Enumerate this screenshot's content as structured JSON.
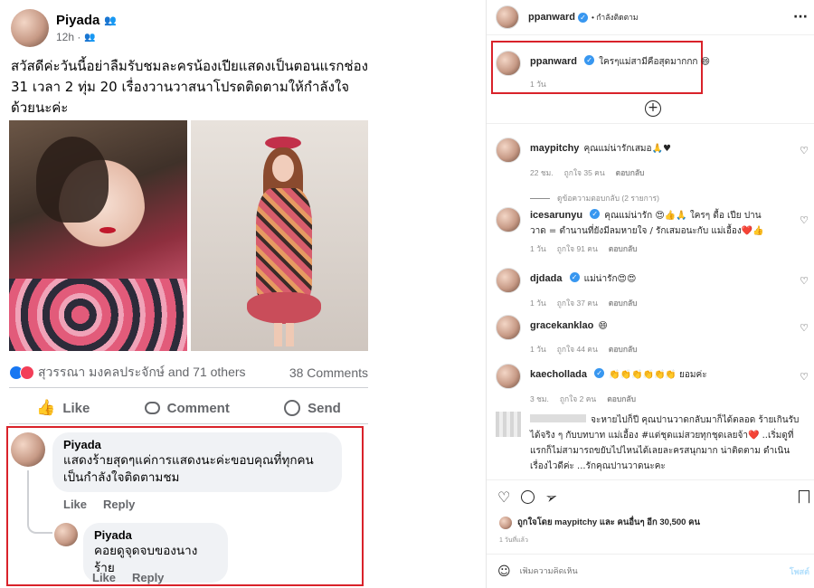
{
  "facebook": {
    "author": "Piyada",
    "meta": "12h ·",
    "post_text": "สวัสดีค่ะวันนี้อย่าลืมรับชมละครน้องเปียแสดงเป็นตอนแรกช่อง 31 เวลา 2 ทุ่ม 20 เรื่องวานวาสนาโปรดติดตามให้กำลังใจด้วยนะค่ะ",
    "reactions_text": "สุวรรณา มงคลประจักษ์ and 71 others",
    "comments_count": "38 Comments",
    "actions": {
      "like": "Like",
      "comment": "Comment",
      "send": "Send"
    },
    "comments": [
      {
        "name": "Piyada",
        "text": "แสดงร้ายสุดๆแค่การแสดงนะค่ะขอบคุณที่ทุกคนเป็นกำลังใจติดตามชม",
        "like": "Like",
        "reply": "Reply"
      },
      {
        "name": "Piyada",
        "text": "คอยดูจุดจบของนางร้าย",
        "like": "Like",
        "reply": "Reply"
      }
    ]
  },
  "instagram": {
    "header_user": "ppanward",
    "header_follow": "• กำลังติดตาม",
    "caption": {
      "user": "ppanward",
      "text": "ใครๆแม่สามีคือสุดมากกก 😄",
      "time": "1 วัน"
    },
    "comments": [
      {
        "user": "maypitchy",
        "verified": false,
        "text": "คุณแม่น่ารักเสมอ🙏♥",
        "time": "22 ชม.",
        "likes": "ถูกใจ 35 คน",
        "reply": "ตอบกลับ",
        "view_replies": "ดูข้อความตอบกลับ (2 รายการ)"
      },
      {
        "user": "icesarunyu",
        "verified": true,
        "text": "คุณแม่น่ารัก 😍👍🙏 ใครๆ ดื้อ เปีย ปานวาด = ตำนานที่ยังมีลมหายใจ / รักเสมอนะกับ แม่เอื้อง❤️👍",
        "time": "1 วัน",
        "likes": "ถูกใจ 91 คน",
        "reply": "ตอบกลับ"
      },
      {
        "user": "djdada",
        "verified": true,
        "text": "แม่น่ารัก😍😍",
        "time": "1 วัน",
        "likes": "ถูกใจ 37 คน",
        "reply": "ตอบกลับ"
      },
      {
        "user": "gracekanklao",
        "verified": false,
        "text": "😄",
        "time": "1 วัน",
        "likes": "ถูกใจ 44 คน",
        "reply": "ตอบกลับ"
      },
      {
        "user": "kaechollada",
        "verified": true,
        "text": "👏👏👏👏👏👏 ยอมค่ะ",
        "time": "3 ชม.",
        "likes": "ถูกใจ 2 คน",
        "reply": "ตอบกลับ"
      },
      {
        "user": "",
        "verified": false,
        "text": "จะหายไปก็ปี คุณปานวาดกลับมาก็ได้ตลอด ร้ายเกินรับได้จริง ๆ กับบทบาท แม่เอื้อง #แต่ชุดแม่สวยทุกชุดเลยจ้า❤️ ..เริ่มดูที่แรกก็ไม่สามารถขยับไปไหนได้เลยละครสนุกมาก น่าติดตาม ดำเนินเรื่องไวดีค่ะ ...รักคุณปานวาดนะคะ"
      }
    ],
    "liked_by": "ถูกใจโดย maypitchy และ คนอื่นๆ อีก 30,500 คน",
    "post_time": "1 วันที่แล้ว",
    "add_comment_placeholder": "เพิ่มความคิดเห็น",
    "post_button": "โพสต์"
  }
}
